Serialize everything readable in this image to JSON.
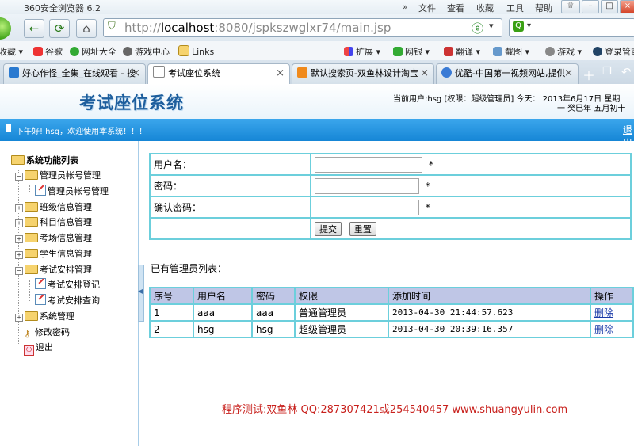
{
  "browser": {
    "title": "360安全浏览器 6.2",
    "menu": [
      "文件",
      "查看",
      "收藏",
      "工具",
      "帮助"
    ],
    "address_prefix": "http://",
    "address_host": "localhost",
    "address_rest": ":8080/jspkszwglxr74/main.jsp",
    "favorites": [
      "收藏",
      "谷歌",
      "网址大全",
      "游戏中心",
      "Links",
      "扩展",
      "网银",
      "翻译",
      "截图",
      "游戏",
      "登录管家"
    ],
    "tabs": [
      {
        "label": "好心作怪_全集_在线观看 - 搜"
      },
      {
        "label": "考试座位系统"
      },
      {
        "label": "默认搜索页-双鱼林设计淘宝"
      },
      {
        "label": "优酷-中国第一视频网站,提供"
      }
    ]
  },
  "header": {
    "system_title": "考试座位系统",
    "user_info": "当前用户:hsg [权限：超级管理员] 今天： 2013年6月17日 星期",
    "date_line2": "一 癸巳年 五月初十",
    "greeting": "下午好! hsg，欢迎使用本系统！！！",
    "logout": "退出"
  },
  "sidebar": {
    "root": "系统功能列表",
    "items": [
      {
        "label": "管理员帐号管理"
      },
      {
        "label": "管理员帐号管理"
      },
      {
        "label": "班级信息管理"
      },
      {
        "label": "科目信息管理"
      },
      {
        "label": "考场信息管理"
      },
      {
        "label": "学生信息管理"
      },
      {
        "label": "考试安排管理"
      },
      {
        "label": "考试安排登记"
      },
      {
        "label": "考试安排查询"
      },
      {
        "label": "系统管理"
      },
      {
        "label": "修改密码"
      },
      {
        "label": "退出"
      }
    ]
  },
  "form": {
    "username_label": "用户名：",
    "password_label": "密码：",
    "confirm_label": "确认密码：",
    "required_mark": "*",
    "submit": "提交",
    "reset": "重置"
  },
  "list": {
    "title": "已有管理员列表：",
    "columns": [
      "序号",
      "用户名",
      "密码",
      "权限",
      "添加时间",
      "操作"
    ],
    "rows": [
      {
        "no": "1",
        "username": "aaa",
        "password": "aaa",
        "role": "普通管理员",
        "added": "2013-04-30 21:44:57.623",
        "action": "删除"
      },
      {
        "no": "2",
        "username": "hsg",
        "password": "hsg",
        "role": "超级管理员",
        "added": "2013-04-30 20:39:16.357",
        "action": "删除"
      }
    ]
  },
  "footer": {
    "text": "程序测试:双鱼林 QQ:287307421或254540457 www.shuangyulin.com"
  },
  "colors": {
    "banner": "#1686d6",
    "table_border": "#6ccfdc",
    "table_header": "#bfc6e6",
    "footer_text": "#c8201c",
    "title_blue": "#1d5e9d"
  }
}
